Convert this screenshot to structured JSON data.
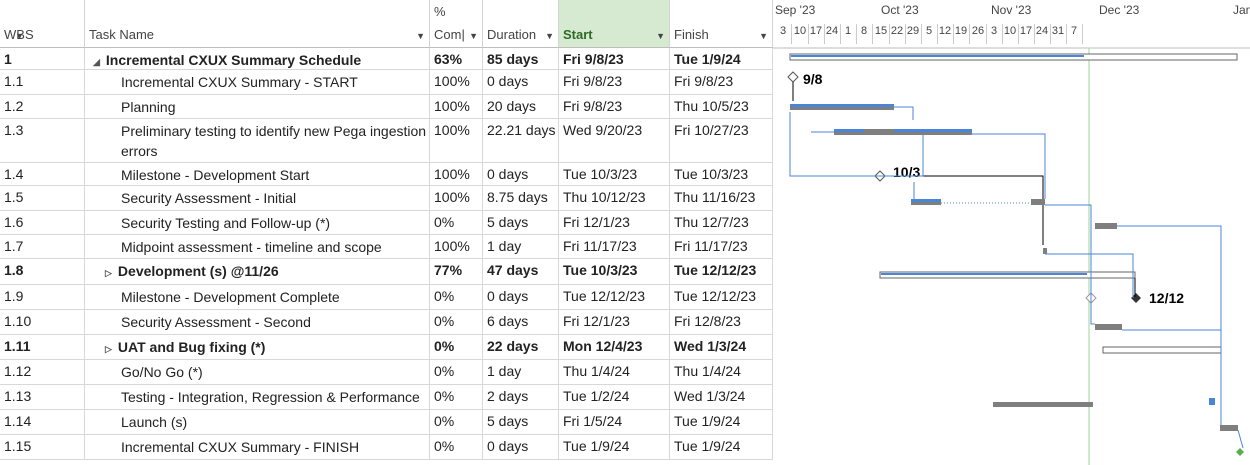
{
  "columns": {
    "wbs": "WBS",
    "task": "Task Name",
    "pct_top": "%",
    "pct": "Com|",
    "duration": "Duration",
    "start": "Start",
    "finish": "Finish"
  },
  "timeline": {
    "months": [
      "Sep '23",
      "Oct '23",
      "Nov '23",
      "Dec '23",
      "Jan '24"
    ],
    "weeks": [
      "3",
      "10",
      "17",
      "24",
      "1",
      "8",
      "15",
      "22",
      "29",
      "5",
      "12",
      "19",
      "26",
      "3",
      "10",
      "17",
      "24",
      "31",
      "7"
    ]
  },
  "tasks": [
    {
      "wbs": "1",
      "name": "Incremental CXUX Summary Schedule",
      "pct": "63%",
      "duration": "85 days",
      "start": "Fri 9/8/23",
      "finish": "Tue 1/9/24",
      "bold": true,
      "marker": "◢"
    },
    {
      "wbs": "1.1",
      "name": "Incremental CXUX Summary - START",
      "pct": "100%",
      "duration": "0 days",
      "start": "Fri 9/8/23",
      "finish": "Fri 9/8/23"
    },
    {
      "wbs": "1.2",
      "name": "Planning",
      "pct": "100%",
      "duration": "20 days",
      "start": "Fri 9/8/23",
      "finish": "Thu 10/5/23"
    },
    {
      "wbs": "1.3",
      "name": "Preliminary testing to identify new Pega ingestion errors",
      "pct": "100%",
      "duration": "22.21 days",
      "start": "Wed 9/20/23",
      "finish": "Fri 10/27/23"
    },
    {
      "wbs": "1.4",
      "name": "Milestone - Development Start",
      "pct": "100%",
      "duration": "0 days",
      "start": "Tue 10/3/23",
      "finish": "Tue 10/3/23"
    },
    {
      "wbs": "1.5",
      "name": "Security Assessment - Initial",
      "pct": "100%",
      "duration": "8.75 days",
      "start": "Thu 10/12/23",
      "finish": "Thu 11/16/23"
    },
    {
      "wbs": "1.6",
      "name": "Security Testing and Follow-up (*)",
      "pct": "0%",
      "duration": "5 days",
      "start": "Fri 12/1/23",
      "finish": "Thu 12/7/23"
    },
    {
      "wbs": "1.7",
      "name": "Midpoint assessment - timeline and scope",
      "pct": "100%",
      "duration": "1 day",
      "start": "Fri 11/17/23",
      "finish": "Fri 11/17/23"
    },
    {
      "wbs": "1.8",
      "name": "Development (s) @11/26",
      "pct": "77%",
      "duration": "47 days",
      "start": "Tue 10/3/23",
      "finish": "Tue 12/12/23",
      "bold": true,
      "marker": "▷"
    },
    {
      "wbs": "1.9",
      "name": "Milestone - Development Complete",
      "pct": "0%",
      "duration": "0 days",
      "start": "Tue 12/12/23",
      "finish": "Tue 12/12/23"
    },
    {
      "wbs": "1.10",
      "name": "Security Assessment - Second",
      "pct": "0%",
      "duration": "6 days",
      "start": "Fri 12/1/23",
      "finish": "Fri 12/8/23"
    },
    {
      "wbs": "1.11",
      "name": "UAT and Bug fixing (*)",
      "pct": "0%",
      "duration": "22 days",
      "start": "Mon 12/4/23",
      "finish": "Wed 1/3/24",
      "bold": true,
      "marker": "▷"
    },
    {
      "wbs": "1.12",
      "name": "Go/No Go (*)",
      "pct": "0%",
      "duration": "1 day",
      "start": "Thu 1/4/24",
      "finish": "Thu 1/4/24"
    },
    {
      "wbs": "1.13",
      "name": "Testing - Integration, Regression & Performance (s)",
      "pct": "0%",
      "duration": "2 days",
      "start": "Tue 1/2/24",
      "finish": "Wed 1/3/24"
    },
    {
      "wbs": "1.14",
      "name": "Launch (s)",
      "pct": "0%",
      "duration": "5 days",
      "start": "Fri 1/5/24",
      "finish": "Tue 1/9/24"
    },
    {
      "wbs": "1.15",
      "name": "Incremental CXUX Summary - FINISH",
      "pct": "0%",
      "duration": "0 days",
      "start": "Tue 1/9/24",
      "finish": "Tue 1/9/24"
    }
  ],
  "milestone_labels": {
    "m1": "9/8",
    "m2": "10/3",
    "m3": "12/12"
  },
  "colors": {
    "bar": "#4a86d8",
    "bar_gray": "#7f7f7f",
    "link": "#4a86d8",
    "status_line": "#9fd39a",
    "start_header": "#d5ead1"
  }
}
